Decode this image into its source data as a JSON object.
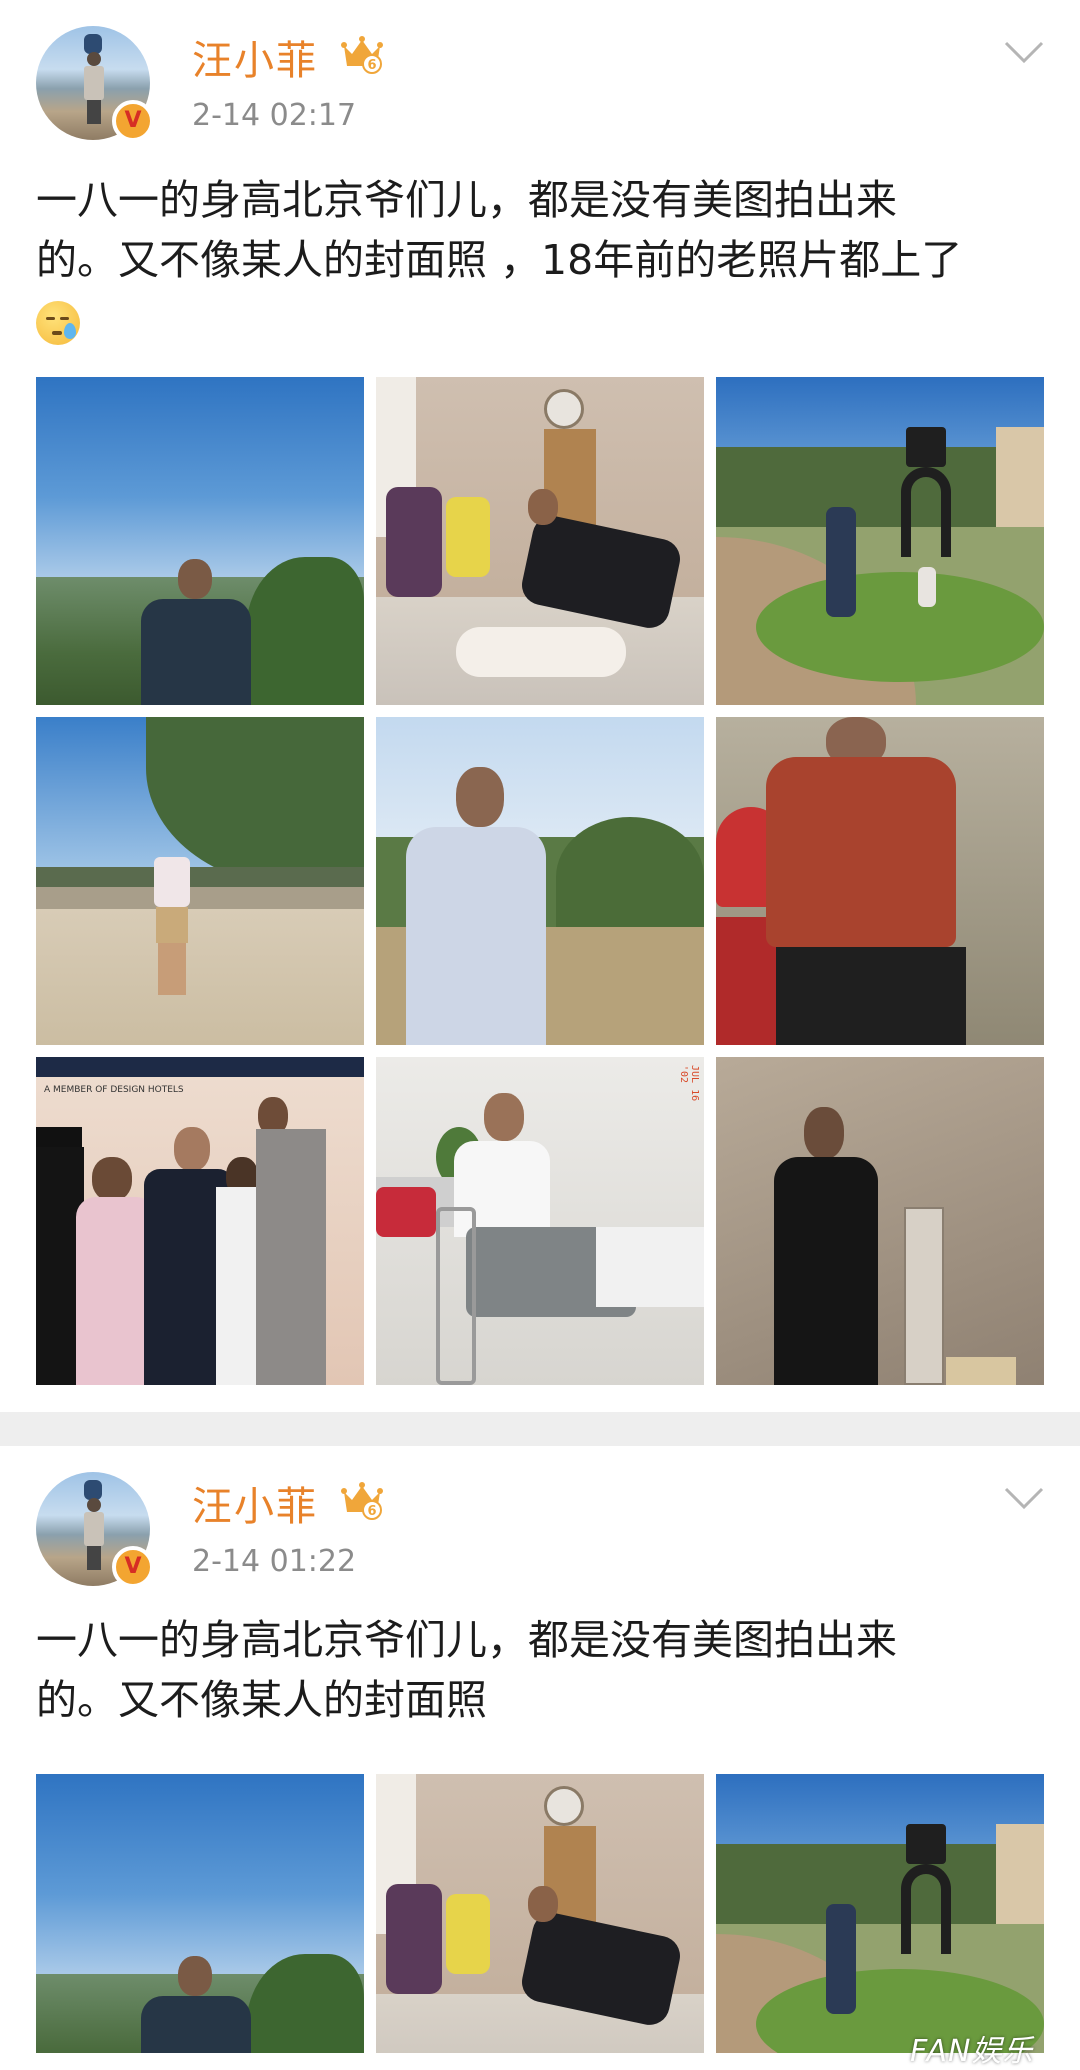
{
  "posts": [
    {
      "username": "汪小菲",
      "time": "2-14 02:17",
      "text_lines": [
        "一八一的身高北京爷们儿，都是没有美图拍出来",
        "的。又不像某人的封面照 ，18年前的老照片都上了"
      ],
      "emoji": "sweat-emoji",
      "photo_count": 9
    },
    {
      "username": "汪小菲",
      "time": "2-14 01:22",
      "text_lines": [
        "一八一的身高北京爷们儿，都是没有美图拍出来",
        "的。又不像某人的封面照"
      ],
      "photo_count": 3
    }
  ],
  "verified_badge": "V",
  "watermark": "FAN娱乐",
  "photo_signs": {
    "hotel_banner": "A MEMBER OF DESIGN HOTELS",
    "photo_date_stamp": "JUL 16 '02"
  },
  "colors": {
    "username": "#e8822a",
    "time": "#8b8b8b",
    "divider": "#eeeeee",
    "crown": "#f0a63a"
  },
  "icons": [
    "crown-level-icon",
    "chevron-down-icon",
    "verified-badge-icon"
  ]
}
